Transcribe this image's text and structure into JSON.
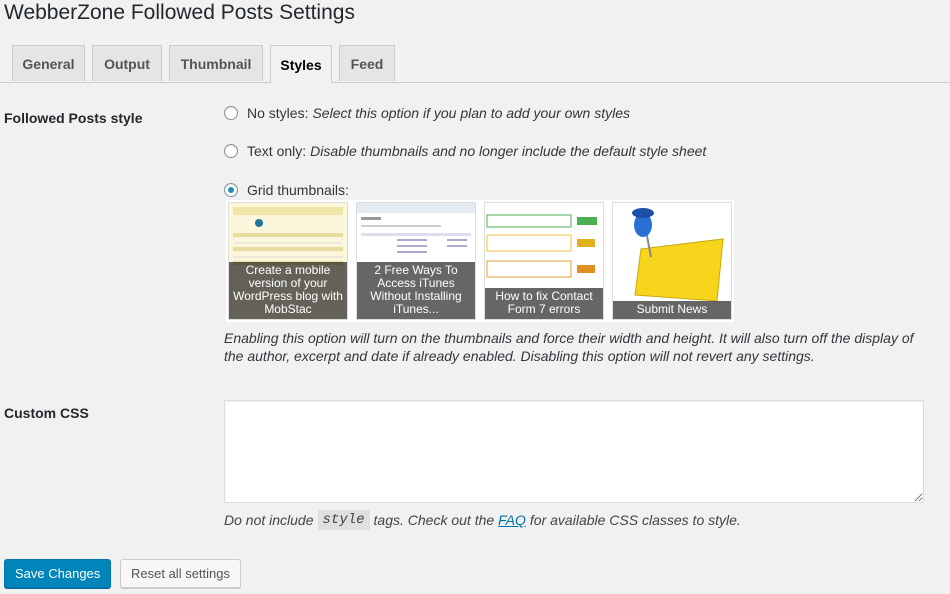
{
  "page": {
    "title": "WebberZone Followed Posts Settings"
  },
  "tabs": [
    {
      "label": "General",
      "active": false
    },
    {
      "label": "Output",
      "active": false
    },
    {
      "label": "Thumbnail",
      "active": false
    },
    {
      "label": "Styles",
      "active": true
    },
    {
      "label": "Feed",
      "active": false
    }
  ],
  "followed_posts_style": {
    "label": "Followed Posts style",
    "options": [
      {
        "label": "No styles:",
        "description": "Select this option if you plan to add your own styles",
        "checked": false
      },
      {
        "label": "Text only:",
        "description": "Disable thumbnails and no longer include the default style sheet",
        "checked": false
      },
      {
        "label": "Grid thumbnails:",
        "description": "",
        "checked": true
      }
    ],
    "thumbnails": [
      {
        "caption": "Create a mobile version of your WordPress blog with MobStac"
      },
      {
        "caption": "2 Free Ways To Access iTunes Without Installing iTunes..."
      },
      {
        "caption": "How to fix Contact Form 7 errors"
      },
      {
        "caption": "Submit News"
      }
    ],
    "grid_description": "Enabling this option will turn on the thumbnails and force their width and height. It will also turn off the display of the author, excerpt and date if already enabled. Disabling this option will not revert any settings."
  },
  "custom_css": {
    "label": "Custom CSS",
    "value": "",
    "help_before": "Do not include",
    "help_code": "style",
    "help_middle": "tags. Check out the",
    "help_link": "FAQ",
    "help_after": "for available CSS classes to style."
  },
  "buttons": {
    "save": "Save Changes",
    "reset": "Reset all settings"
  },
  "colors": {
    "primary": "#0085ba",
    "link": "#0073aa",
    "radio_checked": "#1e8cbe"
  }
}
